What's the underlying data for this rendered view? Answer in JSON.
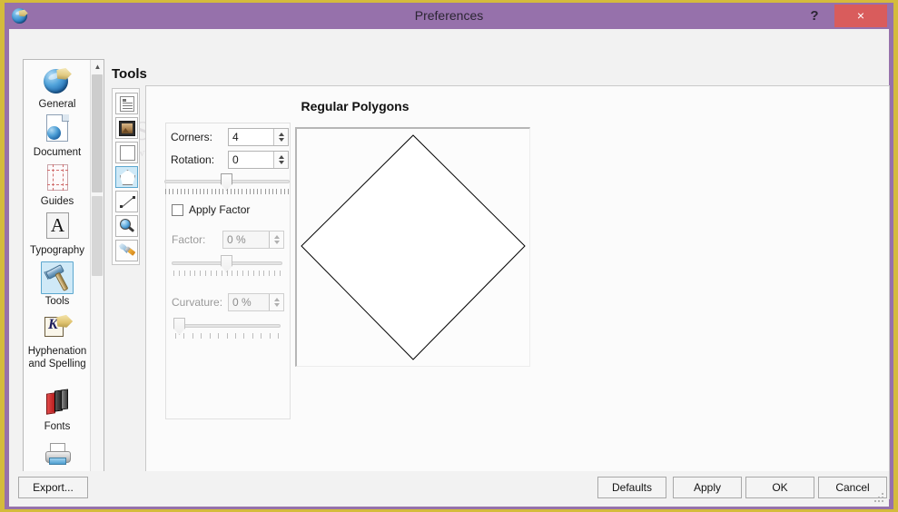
{
  "window": {
    "title": "Preferences",
    "app_icon": "scribus-globe-icon",
    "help_label": "?",
    "close_label": "×",
    "accent_purple": "#9671ab",
    "frame_gold": "#d4bb3c",
    "close_red": "#d95c5c"
  },
  "watermark": {
    "line1": "SOFTPEDIA",
    "line2": "www.softpedia.com",
    "line3": "SOFTPEDIA"
  },
  "categories": {
    "items": [
      {
        "label": "General",
        "icon": "globe-pen-icon",
        "selected": false
      },
      {
        "label": "Document",
        "icon": "document-globe-icon",
        "selected": false
      },
      {
        "label": "Guides",
        "icon": "guides-grid-icon",
        "selected": false
      },
      {
        "label": "Typography",
        "icon": "letter-a-icon",
        "selected": false
      },
      {
        "label": "Tools",
        "icon": "hammer-icon",
        "selected": true
      },
      {
        "label": "Hyphenation and Spelling",
        "icon": "pen-card-icon",
        "selected": false
      },
      {
        "label": "Fonts",
        "icon": "books-icon",
        "selected": false
      },
      {
        "label": "Printer",
        "icon": "printer-icon",
        "selected": false
      }
    ],
    "scroll_up": "▲",
    "scroll_down": "▼"
  },
  "page": {
    "title": "Tools",
    "section_title": "Regular Polygons"
  },
  "tool_strip": {
    "items": [
      {
        "icon": "text-frame-tool-icon",
        "active": false
      },
      {
        "icon": "image-frame-tool-icon",
        "active": false
      },
      {
        "icon": "shape-rectangle-tool-icon",
        "active": false
      },
      {
        "icon": "polygon-tool-icon",
        "active": true
      },
      {
        "icon": "line-tool-icon",
        "active": false
      },
      {
        "icon": "zoom-magnifier-tool-icon",
        "active": false
      },
      {
        "icon": "wrench-screwdriver-tool-icon",
        "active": false
      }
    ]
  },
  "form": {
    "corners": {
      "label": "Corners:",
      "value": "4",
      "disabled": false
    },
    "rotation": {
      "label": "Rotation:",
      "value": "0",
      "disabled": false,
      "slider_percent": 50,
      "tick_count": 33
    },
    "apply_factor": {
      "label": "Apply Factor",
      "checked": false
    },
    "factor": {
      "label": "Factor:",
      "value": "0 %",
      "disabled": true,
      "slider_percent": 50,
      "tick_count": 21
    },
    "curvature": {
      "label": "Curvature:",
      "value": "0 %",
      "disabled": true,
      "slider_percent": 0,
      "tick_count": 13
    }
  },
  "preview": {
    "shape": "diamond-polygon",
    "corners": 4,
    "rotation_degrees": 0,
    "stroke_color": "#000000",
    "fill_color": "#ffffff"
  },
  "buttons": {
    "export": "Export...",
    "defaults": "Defaults",
    "apply": "Apply",
    "ok": "OK",
    "cancel": "Cancel"
  }
}
